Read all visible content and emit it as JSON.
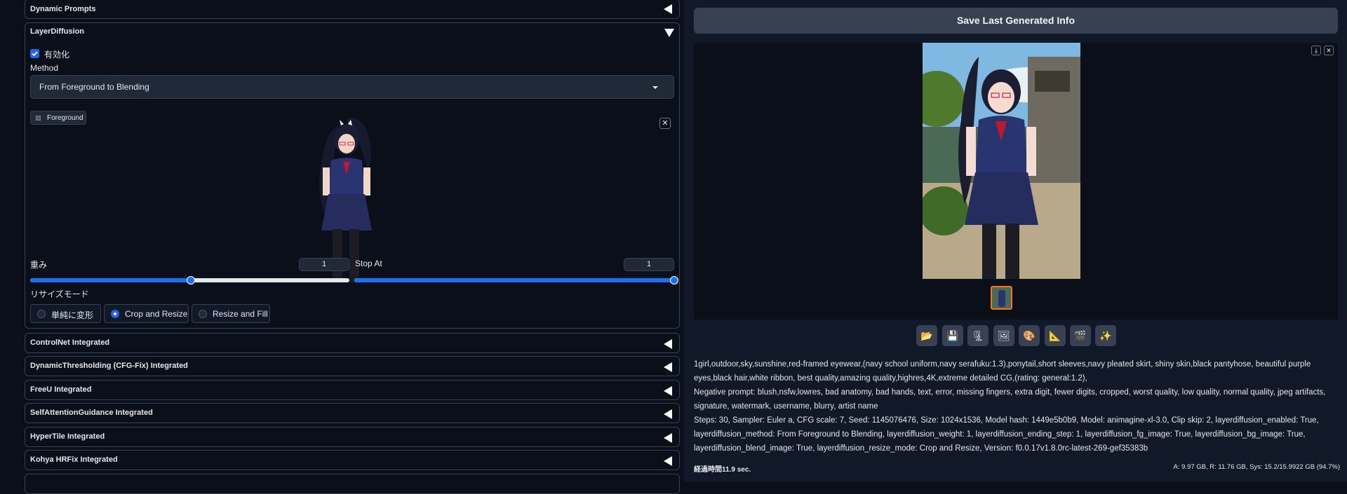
{
  "left": {
    "accordions_top": [
      {
        "label": "Dynamic Prompts"
      }
    ],
    "layer_diffusion": {
      "title": "LayerDiffusion",
      "enable_label": "有効化",
      "enabled": true,
      "method_label": "Method",
      "method_value": "From Foreground to Blending",
      "foreground_label": "Foreground",
      "weight_label": "重み",
      "weight_value": "1",
      "weight_fraction": 0.5,
      "stop_label": "Stop At",
      "stop_value": "1",
      "stop_fraction": 1.0,
      "resize_label": "リサイズモード",
      "resize_options": [
        "単純に変形",
        "Crop and Resize",
        "Resize and Fill"
      ],
      "resize_selected": "Crop and Resize"
    },
    "accordions_bottom": [
      {
        "label": "ControlNet Integrated"
      },
      {
        "label": "DynamicThresholding (CFG-Fix) Integrated"
      },
      {
        "label": "FreeU Integrated"
      },
      {
        "label": "SelfAttentionGuidance Integrated"
      },
      {
        "label": "HyperTile Integrated"
      },
      {
        "label": "Kohya HRFix Integrated"
      }
    ]
  },
  "right": {
    "save_button": "Save Last Generated Info",
    "toolbar_icons": [
      "folder-icon",
      "save-icon",
      "zip-icon",
      "image-icon",
      "palette-icon",
      "ruler-icon",
      "film-icon",
      "sparkle-icon"
    ],
    "prompt": "1girl,outdoor,sky,sunshine,red-framed eyewear,(navy school uniform,navy serafuku:1.3),ponytail,short sleeves,navy pleated skirt, shiny skin,black pantyhose, beautiful purple eyes,black hair,white ribbon, best quality,amazing quality,highres,4K,extreme detailed CG,(rating: general:1.2),",
    "negative_prompt": "Negative prompt: blush,nsfw,lowres, bad anatomy, bad hands, text, error, missing fingers, extra digit, fewer digits, cropped, worst quality, low quality, normal quality, jpeg artifacts, signature, watermark, username, blurry, artist name",
    "params": "Steps: 30, Sampler: Euler a, CFG scale: 7, Seed: 1145076476, Size: 1024x1536, Model hash: 1449e5b0b9, Model: animagine-xl-3.0, Clip skip: 2, layerdiffusion_enabled: True, layerdiffusion_method: From Foreground to Blending, layerdiffusion_weight: 1, layerdiffusion_ending_step: 1, layerdiffusion_fg_image: True, layerdiffusion_bg_image: True, layerdiffusion_blend_image: True, layerdiffusion_resize_mode: Crop and Resize, Version: f0.0.17v1.8.0rc-latest-269-gef35383b",
    "time_label": "経過時間",
    "time_value": "11.9 sec.",
    "vram": "A: 9.97 GB, R: 11.76 GB, Sys: 15.2/15.9922 GB (94.7%)"
  },
  "colors": {
    "accent": "#2563eb",
    "background": "#0b0f19",
    "border": "#374151"
  }
}
